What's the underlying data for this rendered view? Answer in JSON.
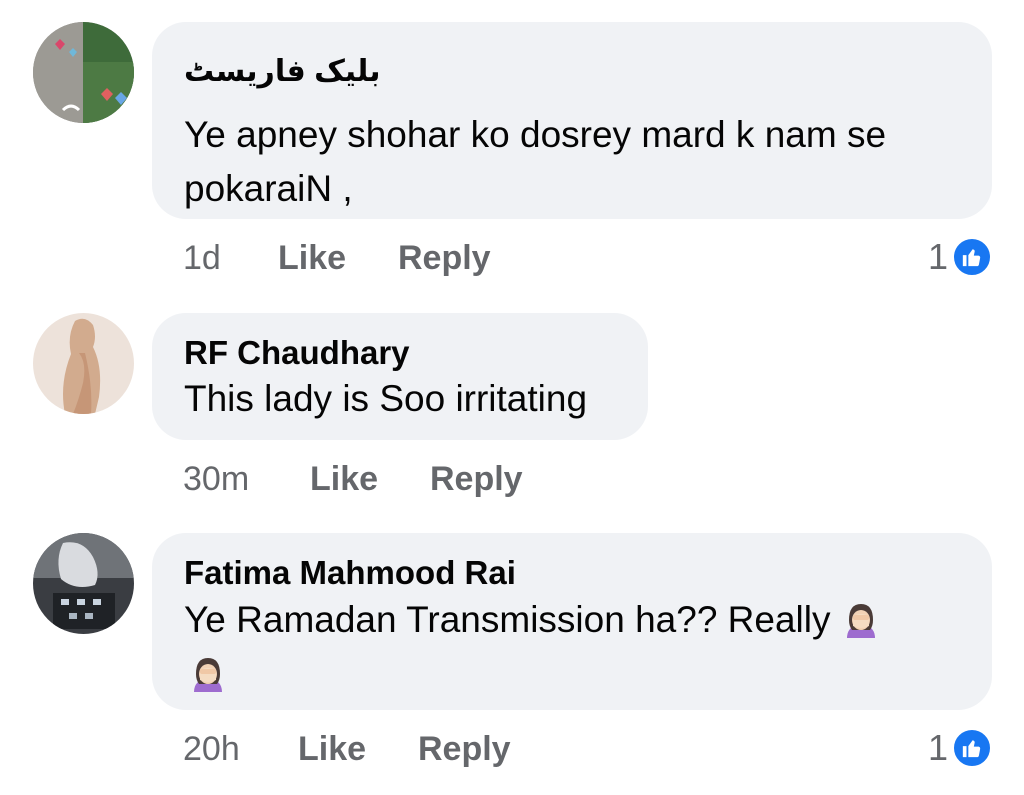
{
  "comments": [
    {
      "author": "بلیک فاریسٹ",
      "text_line1": "Ye apney shohar ko dosrey mard k nam se",
      "text_line2": "pokaraiN ,",
      "time": "1d",
      "like_label": "Like",
      "reply_label": "Reply",
      "reaction_count": "1",
      "reaction_icon": "thumbs-up-icon"
    },
    {
      "author": "RF Chaudhary",
      "text": "This lady is Soo irritating",
      "time": "30m",
      "like_label": "Like",
      "reply_label": "Reply"
    },
    {
      "author": "Fatima Mahmood Rai",
      "text": "Ye Ramadan Transmission ha?? Really",
      "emoji": "face-palm-emoji",
      "time": "20h",
      "like_label": "Like",
      "reply_label": "Reply",
      "reaction_count": "1",
      "reaction_icon": "thumbs-up-icon"
    }
  ],
  "colors": {
    "bubble": "#f0f2f5",
    "meta_text": "#65676b",
    "like_blue": "#1877f2"
  }
}
